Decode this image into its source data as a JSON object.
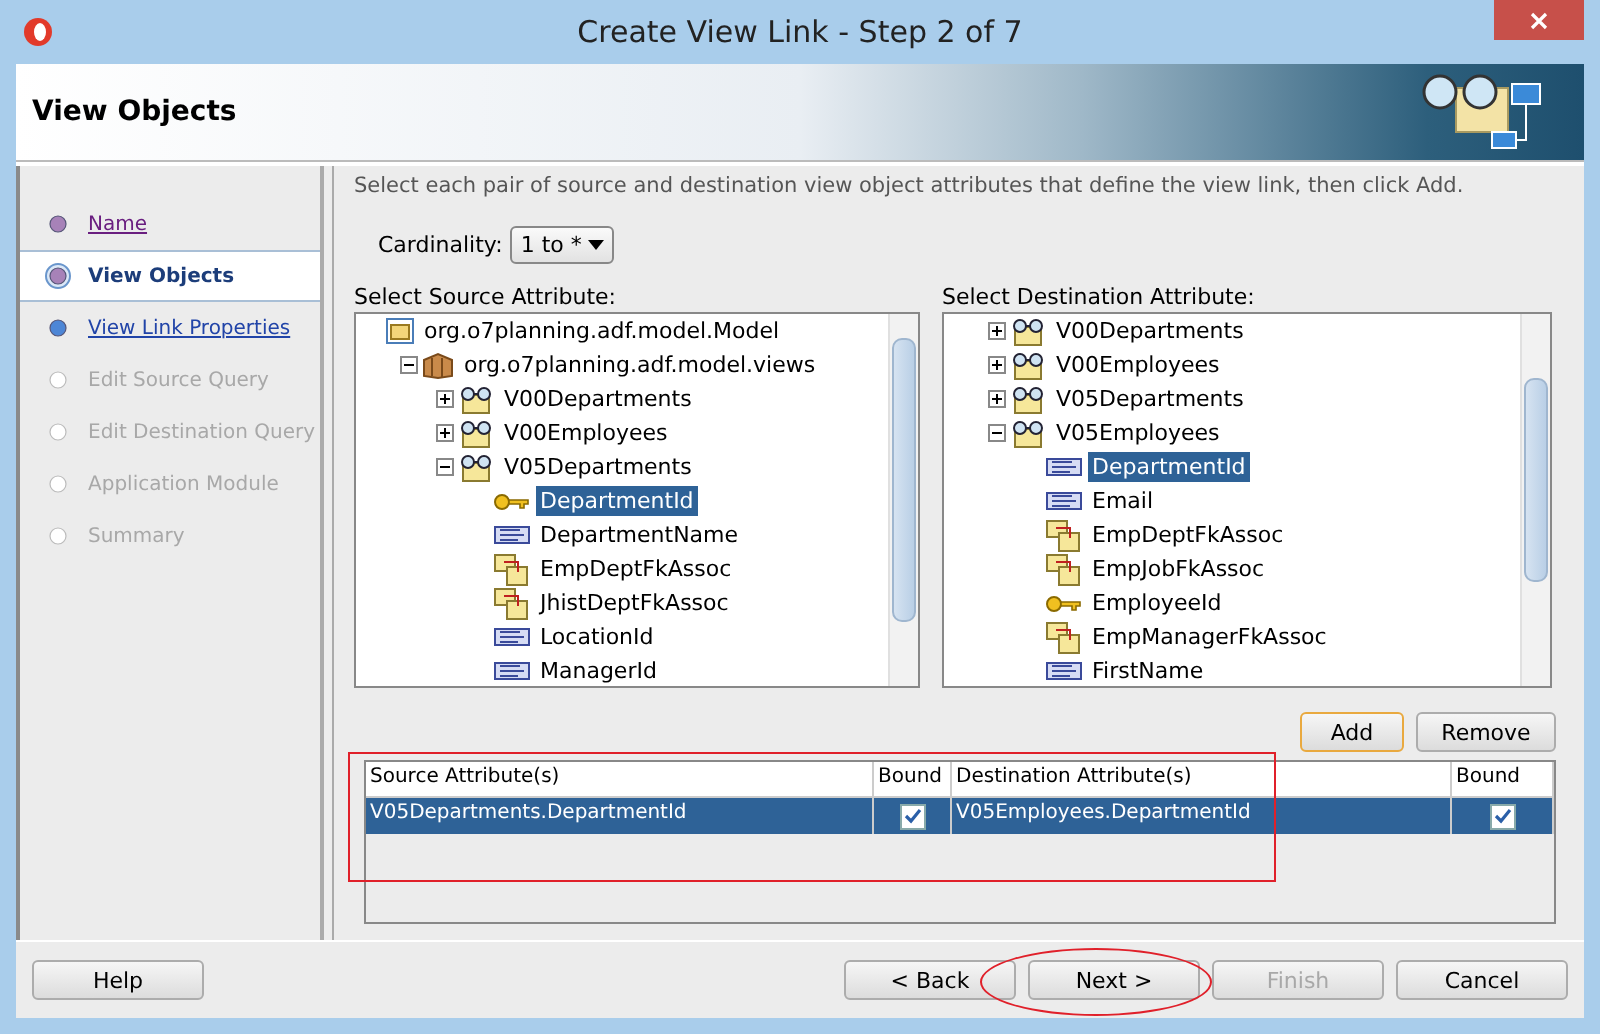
{
  "window": {
    "title": "Create View Link - Step 2 of 7"
  },
  "header": {
    "title": "View Objects"
  },
  "steps": [
    {
      "label": "Name",
      "selected": false,
      "visited": true,
      "disabled": false
    },
    {
      "label": "View Objects",
      "selected": true,
      "visited": true,
      "disabled": false
    },
    {
      "label": "View Link Properties",
      "selected": false,
      "visited": false,
      "disabled": false
    },
    {
      "label": "Edit Source Query",
      "selected": false,
      "visited": false,
      "disabled": true
    },
    {
      "label": "Edit Destination Query",
      "selected": false,
      "visited": false,
      "disabled": true
    },
    {
      "label": "Application Module",
      "selected": false,
      "visited": false,
      "disabled": true
    },
    {
      "label": "Summary",
      "selected": false,
      "visited": false,
      "disabled": true
    }
  ],
  "instruction": "Select each pair of source and destination view object attributes that define the view link, then click Add.",
  "cardinality": {
    "label": "Cardinality:",
    "value": "1 to *"
  },
  "source_tree": {
    "label": "Select Source Attribute:",
    "nodes": [
      {
        "label": "org.o7planning.adf.model.Model",
        "kind": "folder",
        "selected": false,
        "children": [
          {
            "label": "org.o7planning.adf.model.views",
            "kind": "package",
            "expanded": true,
            "selected": false,
            "children": [
              {
                "label": "V00Departments",
                "kind": "view",
                "expanded": false,
                "selected": false
              },
              {
                "label": "V00Employees",
                "kind": "view",
                "expanded": false,
                "selected": false
              },
              {
                "label": "V05Departments",
                "kind": "view",
                "expanded": true,
                "selected": false,
                "children": [
                  {
                    "label": "DepartmentId",
                    "kind": "key",
                    "selected": true
                  },
                  {
                    "label": "DepartmentName",
                    "kind": "attribute",
                    "selected": false
                  },
                  {
                    "label": "EmpDeptFkAssoc",
                    "kind": "association",
                    "selected": false
                  },
                  {
                    "label": "JhistDeptFkAssoc",
                    "kind": "association",
                    "selected": false
                  },
                  {
                    "label": "LocationId",
                    "kind": "attribute",
                    "selected": false
                  },
                  {
                    "label": "ManagerId",
                    "kind": "attribute",
                    "selected": false
                  }
                ]
              }
            ]
          }
        ]
      }
    ]
  },
  "destination_tree": {
    "label": "Select Destination Attribute:",
    "nodes": [
      {
        "label": "V00Departments",
        "kind": "view",
        "expanded": false,
        "selected": false
      },
      {
        "label": "V00Employees",
        "kind": "view",
        "expanded": false,
        "selected": false
      },
      {
        "label": "V05Departments",
        "kind": "view",
        "expanded": false,
        "selected": false
      },
      {
        "label": "V05Employees",
        "kind": "view",
        "expanded": true,
        "selected": false,
        "children": [
          {
            "label": "DepartmentId",
            "kind": "attribute",
            "selected": true
          },
          {
            "label": "Email",
            "kind": "attribute",
            "selected": false
          },
          {
            "label": "EmpDeptFkAssoc",
            "kind": "association",
            "selected": false
          },
          {
            "label": "EmpJobFkAssoc",
            "kind": "association",
            "selected": false
          },
          {
            "label": "EmployeeId",
            "kind": "key",
            "selected": false
          },
          {
            "label": "EmpManagerFkAssoc",
            "kind": "association",
            "selected": false
          },
          {
            "label": "FirstName",
            "kind": "attribute",
            "selected": false
          }
        ]
      }
    ]
  },
  "list_buttons": [
    {
      "label": "Add",
      "focused": true
    },
    {
      "label": "Remove",
      "focused": false
    }
  ],
  "table": {
    "columns": [
      "Source Attribute(s)",
      "Bound",
      "Destination Attribute(s)",
      "Bound"
    ],
    "rows": [
      {
        "source": "V05Departments.DepartmentId",
        "source_bound": true,
        "destination": "V05Employees.DepartmentId",
        "destination_bound": true,
        "selected": true
      }
    ]
  },
  "help_button": "Help",
  "nav_buttons": [
    {
      "label": "< Back",
      "disabled": false
    },
    {
      "label": "Next >",
      "disabled": false
    },
    {
      "label": "Finish",
      "disabled": true
    },
    {
      "label": "Cancel",
      "disabled": false
    }
  ]
}
